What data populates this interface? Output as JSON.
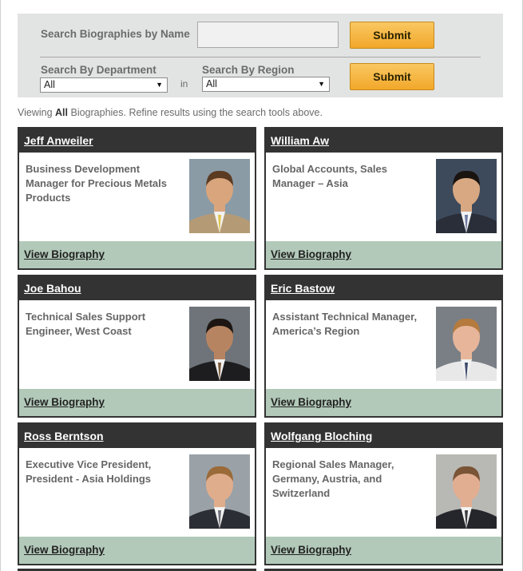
{
  "search": {
    "name_label": "Search Biographies by Name",
    "name_value": "",
    "submit_label": "Submit",
    "department_label": "Search By Department",
    "department_value": "All",
    "in_label": "in",
    "region_label": "Search By Region",
    "region_value": "All",
    "submit2_label": "Submit"
  },
  "viewing": {
    "prefix": "Viewing ",
    "scope": "All",
    "suffix": " Biographies. Refine results using the search tools above."
  },
  "cards": [
    {
      "name": "Jeff Anweiler",
      "title": "Business Development Manager for Precious Metals Products",
      "link": "View Biography",
      "photo": {
        "bg": "#8a9ba6",
        "skin": "#d9a57d",
        "hair": "#5b3b22",
        "suit": "#b59a76",
        "tie": "#e1c54a"
      }
    },
    {
      "name": "William Aw",
      "title": "Global Accounts, Sales Manager – Asia",
      "link": "View Biography",
      "photo": {
        "bg": "#3d4a5c",
        "skin": "#d8a882",
        "hair": "#1a1410",
        "suit": "#2a2e38",
        "tie": "#6c7aa0"
      }
    },
    {
      "name": "Joe Bahou",
      "title": "Technical Sales Support Engineer, West Coast",
      "link": "View Biography",
      "photo": {
        "bg": "#6e747a",
        "skin": "#b78462",
        "hair": "#1e1612",
        "suit": "#1d1d1f",
        "tie": "#7a5a3a"
      }
    },
    {
      "name": "Eric Bastow",
      "title": "Assistant Technical Manager, America’s Region",
      "link": "View Biography",
      "photo": {
        "bg": "#7a7f86",
        "skin": "#e7b69a",
        "hair": "#b47a3e",
        "suit": "#e8e8e8",
        "tie": "#3d4a6a"
      }
    },
    {
      "name": "Ross Berntson",
      "title": "Executive Vice President, President - Asia Holdings",
      "link": "View Biography",
      "photo": {
        "bg": "#9aa2a8",
        "skin": "#e0ad8c",
        "hair": "#9a6a38",
        "suit": "#2b2e34",
        "tie": "#6f6f7a"
      }
    },
    {
      "name": "Wolfgang Bloching",
      "title": "Regional Sales Manager, Germany, Austria, and Switzerland",
      "link": "View Biography",
      "photo": {
        "bg": "#b8b8b4",
        "skin": "#e2ae91",
        "hair": "#7a5436",
        "suit": "#24262b",
        "tie": "#3b3b40"
      }
    }
  ]
}
